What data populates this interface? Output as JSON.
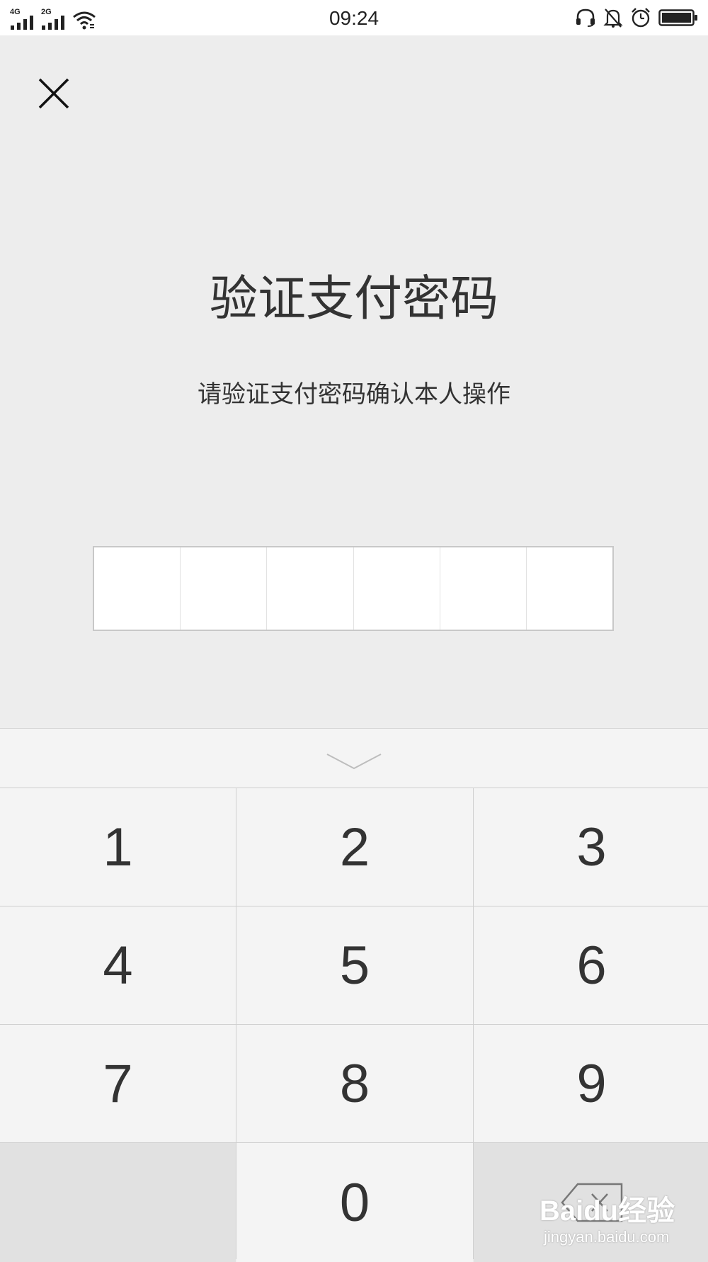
{
  "status_bar": {
    "time": "09:24",
    "signal_1": "4G",
    "signal_2": "2G",
    "icons": [
      "signal-icon",
      "wifi-icon",
      "headset-icon",
      "bell-muted-icon",
      "alarm-icon",
      "battery-icon"
    ]
  },
  "page": {
    "title": "验证支付密码",
    "subtitle": "请验证支付密码确认本人操作"
  },
  "pin": {
    "length": 6,
    "entered": 0
  },
  "keypad": {
    "keys": [
      "1",
      "2",
      "3",
      "4",
      "5",
      "6",
      "7",
      "8",
      "9",
      "0"
    ],
    "collapse_icon": "chevron-down-icon",
    "delete_icon": "backspace-icon"
  },
  "watermark": {
    "brand": "Baidu经验",
    "url": "jingyan.baidu.com"
  },
  "colors": {
    "background": "#ededed",
    "keypad_key": "#f4f4f4",
    "keypad_key_dark": "#e1e1e1",
    "text": "#333333"
  }
}
